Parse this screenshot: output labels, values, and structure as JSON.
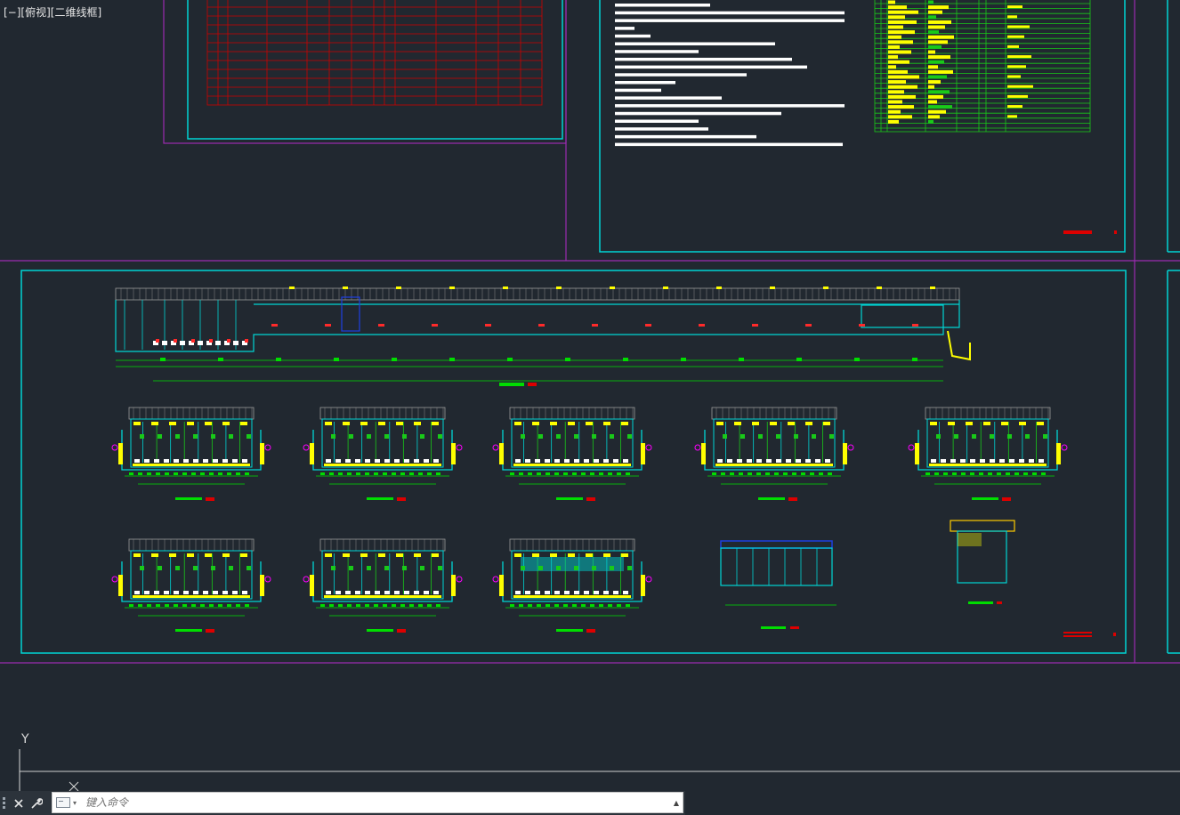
{
  "viewport": {
    "view_controls_label": "[−][俯视][二维线框]",
    "background": "#212830"
  },
  "ucs": {
    "y_label": "Y"
  },
  "command_line": {
    "placeholder": "键入命令",
    "close_icon": "close-icon",
    "customize_icon": "wrench-icon",
    "recent_commands_icon": "command-history-icon",
    "expand_icon": "caret-up-icon"
  },
  "colors": {
    "frame_cyan": "#00d4d4",
    "layout_magenta": "#9b2bb0",
    "table_red": "#cc0000",
    "table_green": "#19c919",
    "highlight_yellow": "#ffff00",
    "notes_white": "#ffffff",
    "dimension_green": "#00dd00",
    "tag_magenta": "#ff00ff",
    "accent_blue": "#1e3fe0"
  }
}
